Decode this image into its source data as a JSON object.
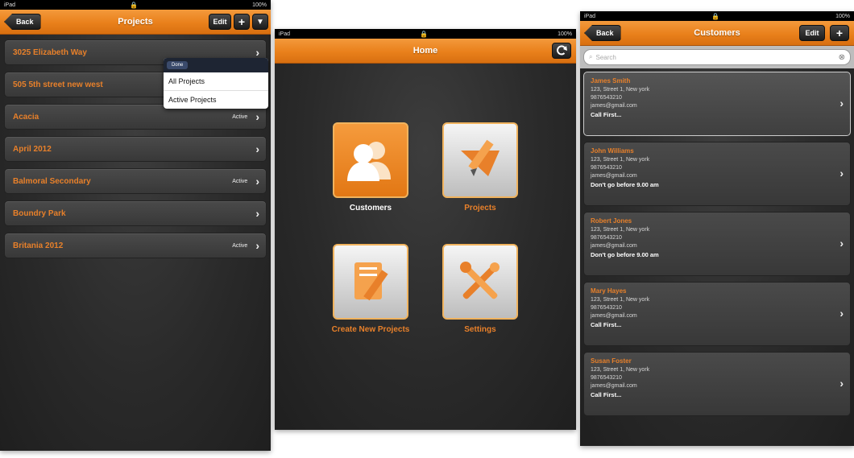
{
  "status": {
    "device": "iPad",
    "battery": "100%"
  },
  "left": {
    "back": "Back",
    "title": "Projects",
    "edit": "Edit",
    "add": "+",
    "filter": "▼",
    "rows": [
      {
        "name": "3025 Elizabeth Way",
        "status": ""
      },
      {
        "name": "505 5th street new west",
        "status": ""
      },
      {
        "name": "Acacia",
        "status": "Active"
      },
      {
        "name": "April 2012",
        "status": ""
      },
      {
        "name": "Balmoral Secondary",
        "status": "Active"
      },
      {
        "name": "Boundry Park",
        "status": ""
      },
      {
        "name": "Britania 2012",
        "status": "Active"
      }
    ],
    "dropdown": {
      "done": "Done",
      "items": [
        "All Projects",
        "Active Projects"
      ]
    }
  },
  "middle": {
    "title": "Home",
    "tiles": [
      {
        "label": "Customers",
        "label_color": "#ffffff"
      },
      {
        "label": "Projects",
        "label_color": "#e8802a"
      },
      {
        "label": "Create New Projects",
        "label_color": "#e8802a"
      },
      {
        "label": "Settings",
        "label_color": "#e8802a"
      }
    ]
  },
  "right": {
    "back": "Back",
    "title": "Customers",
    "edit": "Edit",
    "add": "+",
    "search_placeholder": "Search",
    "customers": [
      {
        "name": "James Smith",
        "address": "123, Street 1, New york",
        "phone": "9876543210",
        "email": "james@gmail.com",
        "note": "Call First..."
      },
      {
        "name": "John Williams",
        "address": "123, Street 1, New york",
        "phone": "9876543210",
        "email": "james@gmail.com",
        "note": "Don't go before 9.00 am"
      },
      {
        "name": "Robert Jones",
        "address": "123, Street 1, New york",
        "phone": "9876543210",
        "email": "james@gmail.com",
        "note": "Don't go before 9.00 am"
      },
      {
        "name": "Mary Hayes",
        "address": "123, Street 1, New york",
        "phone": "9876543210",
        "email": "james@gmail.com",
        "note": "Call First..."
      },
      {
        "name": "Susan Foster",
        "address": "123, Street 1, New york",
        "phone": "9876543210",
        "email": "james@gmail.com",
        "note": "Call First..."
      }
    ]
  },
  "colors": {
    "accent": "#e9801b",
    "panel": "#2a2a2a",
    "label_orange": "#e8802a"
  }
}
